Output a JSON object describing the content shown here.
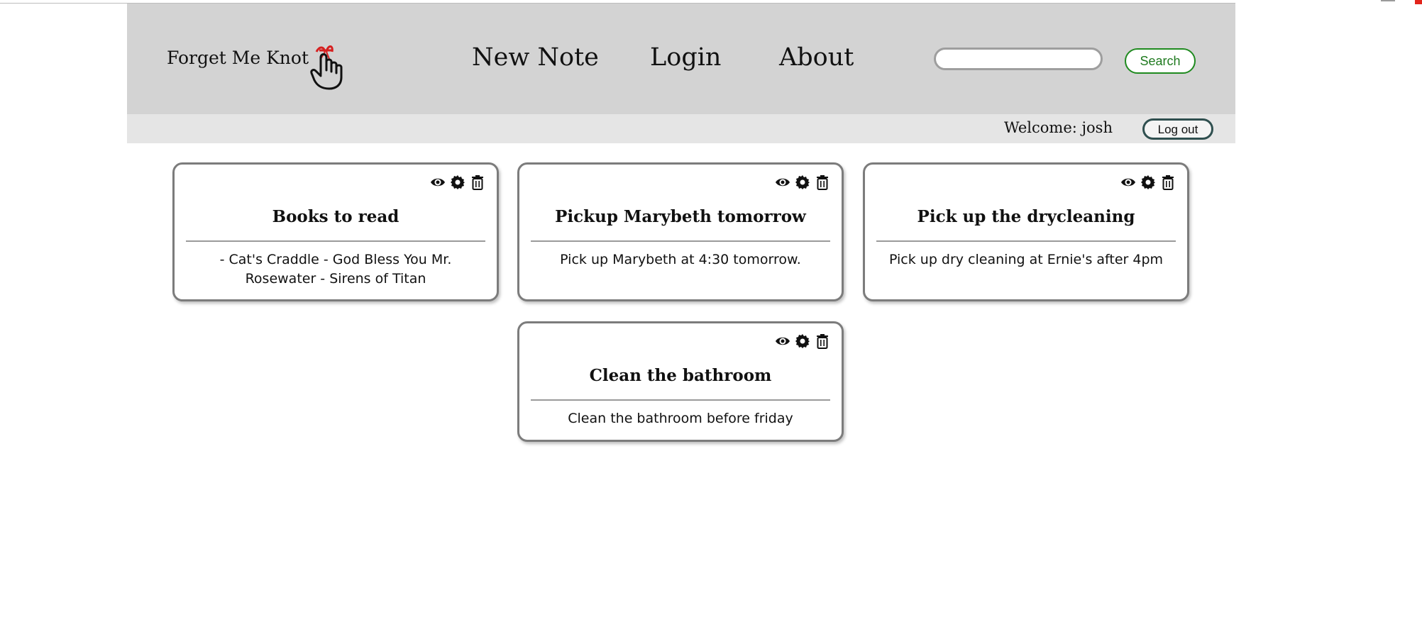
{
  "brand": {
    "name": "Forget Me Knot"
  },
  "nav": {
    "new_note": "New Note",
    "login": "Login",
    "about": "About"
  },
  "search": {
    "placeholder": "",
    "button_label": "Search"
  },
  "user_bar": {
    "welcome": "Welcome: josh",
    "logout_label": "Log out"
  },
  "notes": [
    {
      "title": "Books to read",
      "body": "- Cat's Craddle - God Bless You Mr. Rosewater - Sirens of Titan"
    },
    {
      "title": "Pickup Marybeth tomorrow",
      "body": "Pick up Marybeth at 4:30 tomorrow."
    },
    {
      "title": "Pick up the drycleaning",
      "body": "Pick up dry cleaning at Ernie's after 4pm"
    },
    {
      "title": "Clean the bathroom",
      "body": "Clean the bathroom before friday"
    }
  ],
  "icons": {
    "logo": "finger-with-red-bow-icon",
    "view": "eye-icon",
    "edit": "gear-icon",
    "delete": "trash-icon"
  },
  "colors": {
    "header_bg": "#d3d3d3",
    "subbar_bg": "#e5e5e5",
    "search_green": "#1f8a1f",
    "card_border": "#7c7c7c",
    "logo_bow": "#d62020"
  }
}
